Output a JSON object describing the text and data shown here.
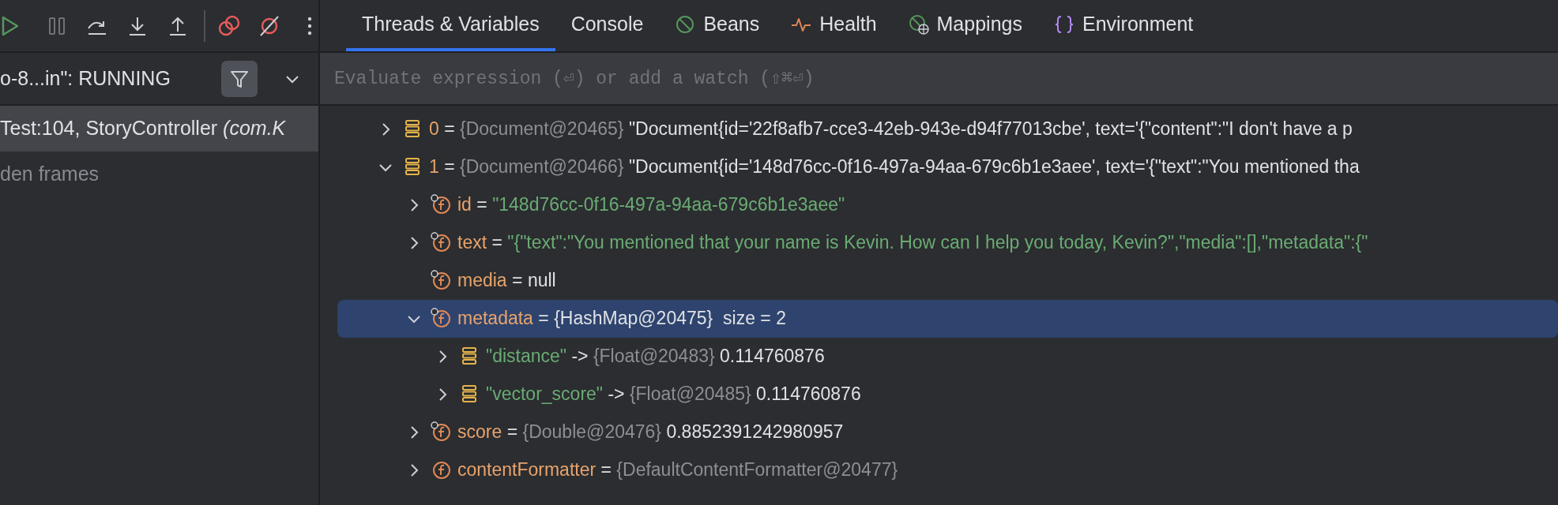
{
  "tabs": [
    {
      "label": "Threads & Variables",
      "selected": true,
      "kind": "plain"
    },
    {
      "label": "Console",
      "selected": false,
      "kind": "plain"
    },
    {
      "label": "Beans",
      "selected": false,
      "kind": "beans"
    },
    {
      "label": "Health",
      "selected": false,
      "kind": "health"
    },
    {
      "label": "Mappings",
      "selected": false,
      "kind": "mappings"
    },
    {
      "label": "Environment",
      "selected": false,
      "kind": "environment"
    }
  ],
  "thread_selector": {
    "text": "o-8...in\": RUNNING"
  },
  "evaluate_field": {
    "placeholder": "Evaluate expression (⏎) or add a watch (⇧⌘⏎)"
  },
  "frames": [
    {
      "text": "Test:104, StoryController *(com.K*",
      "selected": true,
      "kind": "frame"
    },
    {
      "text": "den frames",
      "selected": false,
      "kind": "hint"
    }
  ],
  "variables": [
    {
      "kind": "array",
      "name": "0",
      "operator": "=",
      "type": "{Document@20465}",
      "value": {
        "text": "\"Document{id='22f8afb7-cce3-42eb-943e-d94f77013cbe', text='{\"content\":\"I don't have a p",
        "kind": "plain"
      },
      "expandable": true,
      "expanded": false,
      "marked": false,
      "selected": false
    },
    {
      "kind": "array",
      "name": "1",
      "operator": "=",
      "type": "{Document@20466}",
      "value": {
        "text": "\"Document{id='148d76cc-0f16-497a-94aa-679c6b1e3aee', text='{\"text\":\"You mentioned tha",
        "kind": "plain"
      },
      "expandable": true,
      "expanded": true,
      "marked": false,
      "selected": false,
      "children": [
        {
          "kind": "field",
          "name": "id",
          "operator": "=",
          "value": {
            "text": "\"148d76cc-0f16-497a-94aa-679c6b1e3aee\"",
            "kind": "string"
          },
          "expandable": true,
          "expanded": false,
          "marked": true,
          "selected": false
        },
        {
          "kind": "field",
          "name": "text",
          "operator": "=",
          "value": {
            "text": "\"{\"text\":\"You mentioned that your name is Kevin. How can I help you today, Kevin?\",\"media\":[],\"metadata\":{\"",
            "kind": "string"
          },
          "expandable": true,
          "expanded": false,
          "marked": true,
          "selected": false
        },
        {
          "kind": "field",
          "name": "media",
          "operator": "=",
          "value": {
            "text": "null",
            "kind": "plain"
          },
          "expandable": false,
          "marked": true,
          "selected": false
        },
        {
          "kind": "field",
          "name": "metadata",
          "operator": "=",
          "type": "{HashMap@20475}",
          "value": {
            "text": "size = 2",
            "kind": "plain"
          },
          "expandable": true,
          "expanded": true,
          "marked": true,
          "selected": true,
          "children": [
            {
              "kind": "entry",
              "name": "\"distance\"",
              "operator": "->",
              "type": "{Float@20483}",
              "value": {
                "text": "0.114760876",
                "kind": "plain"
              },
              "expandable": true,
              "expanded": false,
              "marked": false,
              "selected": false
            },
            {
              "kind": "entry",
              "name": "\"vector_score\"",
              "operator": "->",
              "type": "{Float@20485}",
              "value": {
                "text": "0.114760876",
                "kind": "plain"
              },
              "expandable": true,
              "expanded": false,
              "marked": false,
              "selected": false
            }
          ]
        },
        {
          "kind": "field",
          "name": "score",
          "operator": "=",
          "type": "{Double@20476}",
          "value": {
            "text": "0.8852391242980957",
            "kind": "plain"
          },
          "expandable": true,
          "expanded": false,
          "marked": true,
          "selected": false
        },
        {
          "kind": "field",
          "name": "contentFormatter",
          "operator": "=",
          "type": "{DefaultContentFormatter@20477}",
          "expandable": true,
          "expanded": false,
          "marked": false,
          "selected": false
        }
      ]
    }
  ]
}
